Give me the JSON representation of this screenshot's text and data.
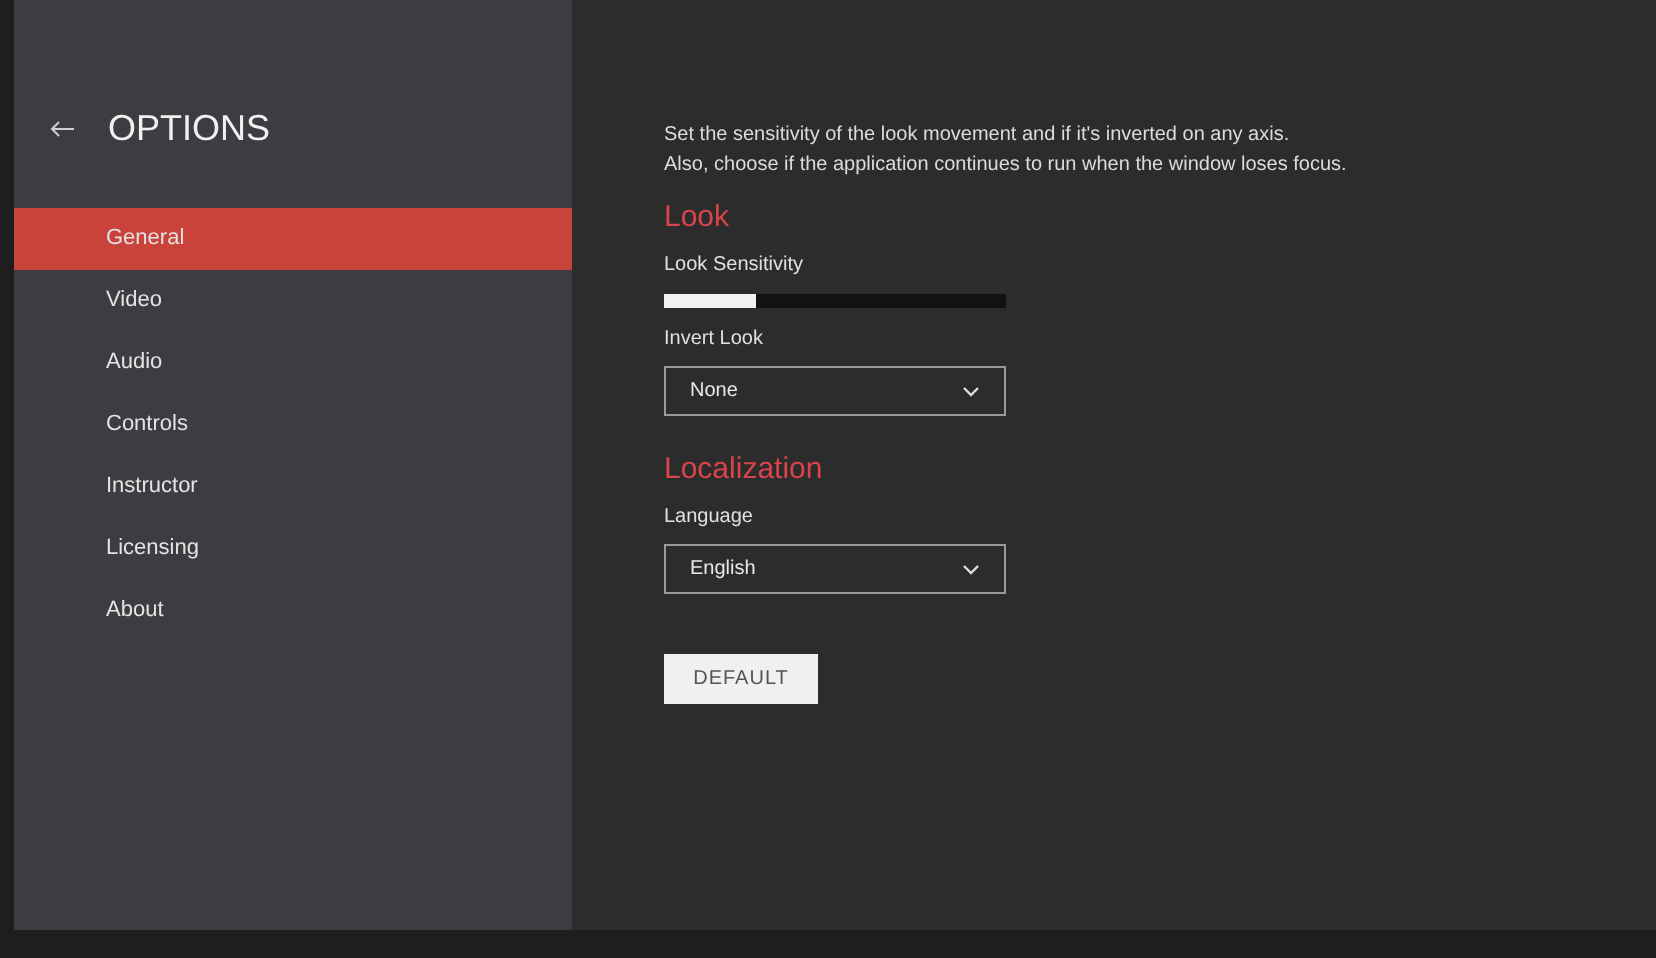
{
  "sidebar": {
    "title": "OPTIONS",
    "items": [
      {
        "label": "General",
        "selected": true
      },
      {
        "label": "Video",
        "selected": false
      },
      {
        "label": "Audio",
        "selected": false
      },
      {
        "label": "Controls",
        "selected": false
      },
      {
        "label": "Instructor",
        "selected": false
      },
      {
        "label": "Licensing",
        "selected": false
      },
      {
        "label": "About",
        "selected": false
      }
    ]
  },
  "main": {
    "description": [
      "Set the sensitivity of the look movement and if it's inverted on any axis.",
      "Also, choose if the application continues to run when the window loses focus."
    ],
    "sections": [
      {
        "heading": "Look",
        "fields": [
          {
            "kind": "slider",
            "label": "Look Sensitivity",
            "level": 0.27
          },
          {
            "kind": "dropdown",
            "label": "Invert Look",
            "value": "None"
          }
        ]
      },
      {
        "heading": "Localization",
        "fields": [
          {
            "kind": "dropdown",
            "label": "Language",
            "value": "English"
          }
        ]
      }
    ],
    "default_button": "DEFAULT"
  }
}
